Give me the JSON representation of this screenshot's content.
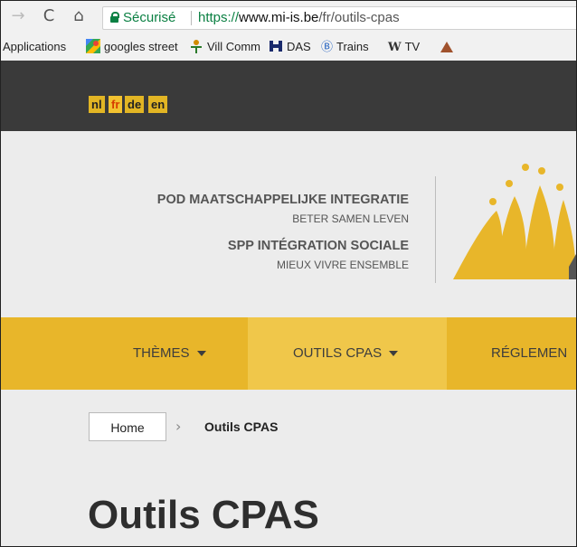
{
  "browser": {
    "back_icon": "arrow-left-icon",
    "reload_icon": "reload-icon",
    "home_icon": "home-icon",
    "secure_label": "Sécurisé",
    "url_scheme": "https://",
    "url_host": "www.mi-is.be",
    "url_path": "/fr/outils-cpas",
    "colors": {
      "secure": "#0b8043"
    }
  },
  "bookmarks": [
    {
      "label": "Applications"
    },
    {
      "label": "googles street",
      "icon": "maps-icon"
    },
    {
      "label": "Vill Comm",
      "icon": "person-icon"
    },
    {
      "label": "DAS",
      "icon": "cross-icon"
    },
    {
      "label": "Trains",
      "icon": "b-circle-icon",
      "glyph": "Ⓑ"
    },
    {
      "label": "TV",
      "icon": "w-icon",
      "glyph": "W"
    }
  ],
  "languages": [
    {
      "code": "nl",
      "active": false
    },
    {
      "code": "fr",
      "active": true
    },
    {
      "code": "de",
      "active": false
    },
    {
      "code": "en",
      "active": false
    }
  ],
  "logo": {
    "line1": "POD MAATSCHAPPELIJKE INTEGRATIE",
    "line2": "BETER SAMEN LEVEN",
    "line3": "SPP INTÉGRATION SOCIALE",
    "line4": "MIEUX VIVRE ENSEMBLE",
    "colors": {
      "yellow": "#e8b62a",
      "grey": "#555555"
    }
  },
  "nav": [
    {
      "label": "THÈMES",
      "dropdown": true,
      "active": false
    },
    {
      "label": "OUTILS CPAS",
      "dropdown": true,
      "active": true
    },
    {
      "label": "RÉGLEMEN",
      "dropdown": false,
      "active": false
    }
  ],
  "breadcrumb": {
    "home": "Home",
    "current": "Outils CPAS"
  },
  "page": {
    "title": "Outils CPAS"
  }
}
